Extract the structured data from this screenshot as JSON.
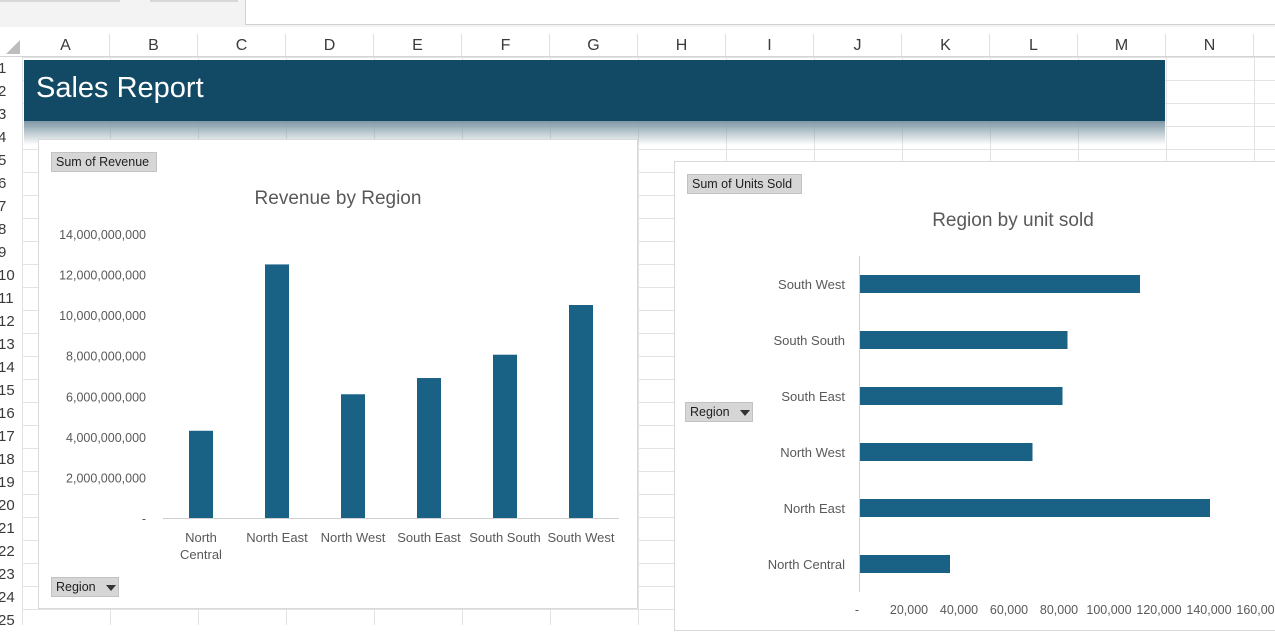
{
  "sheet": {
    "columns": [
      "A",
      "B",
      "C",
      "D",
      "E",
      "F",
      "G",
      "H",
      "I",
      "J",
      "K",
      "L",
      "M",
      "N"
    ],
    "rows": [
      "1",
      "2",
      "3",
      "4",
      "5",
      "6",
      "7",
      "8",
      "9",
      "10",
      "11",
      "12",
      "13",
      "14",
      "15",
      "16",
      "17",
      "18",
      "19",
      "20",
      "21",
      "22",
      "23",
      "24",
      "25"
    ]
  },
  "banner": {
    "title": "Sales Report",
    "color": "#124a66"
  },
  "charts": {
    "revenue": {
      "field_button": "Sum of Revenue",
      "axis_field_button": "Region",
      "title": "Revenue by Region"
    },
    "units": {
      "field_button": "Sum of Units Sold",
      "axis_field_button": "Region",
      "title": "Region by unit sold"
    }
  },
  "chart_data": [
    {
      "type": "bar",
      "title": "Revenue by Region",
      "categories": [
        "North Central",
        "North East",
        "North West",
        "South East",
        "South South",
        "South West"
      ],
      "values": [
        4300000000,
        12500000000,
        6100000000,
        6900000000,
        8050000000,
        10500000000
      ],
      "ylim": [
        0,
        14000000000
      ],
      "yticks": [
        "-",
        "2,000,000,000",
        "4,000,000,000",
        "6,000,000,000",
        "8,000,000,000",
        "10,000,000,000",
        "12,000,000,000",
        "14,000,000,000"
      ],
      "color": "#1a6186",
      "grid": false,
      "legend": "none"
    },
    {
      "type": "bar",
      "orientation": "horizontal",
      "title": "Region by unit sold",
      "categories": [
        "South West",
        "South South",
        "South East",
        "North West",
        "North East",
        "North Central"
      ],
      "values": [
        112000,
        83000,
        81000,
        69000,
        140000,
        36000
      ],
      "xlim": [
        0,
        160000
      ],
      "xticks": [
        "-",
        "20,000",
        "40,000",
        "60,000",
        "80,000",
        "100,000",
        "120,000",
        "140,000",
        "160,000"
      ],
      "color": "#1a6186",
      "grid": false,
      "legend": "none"
    }
  ]
}
